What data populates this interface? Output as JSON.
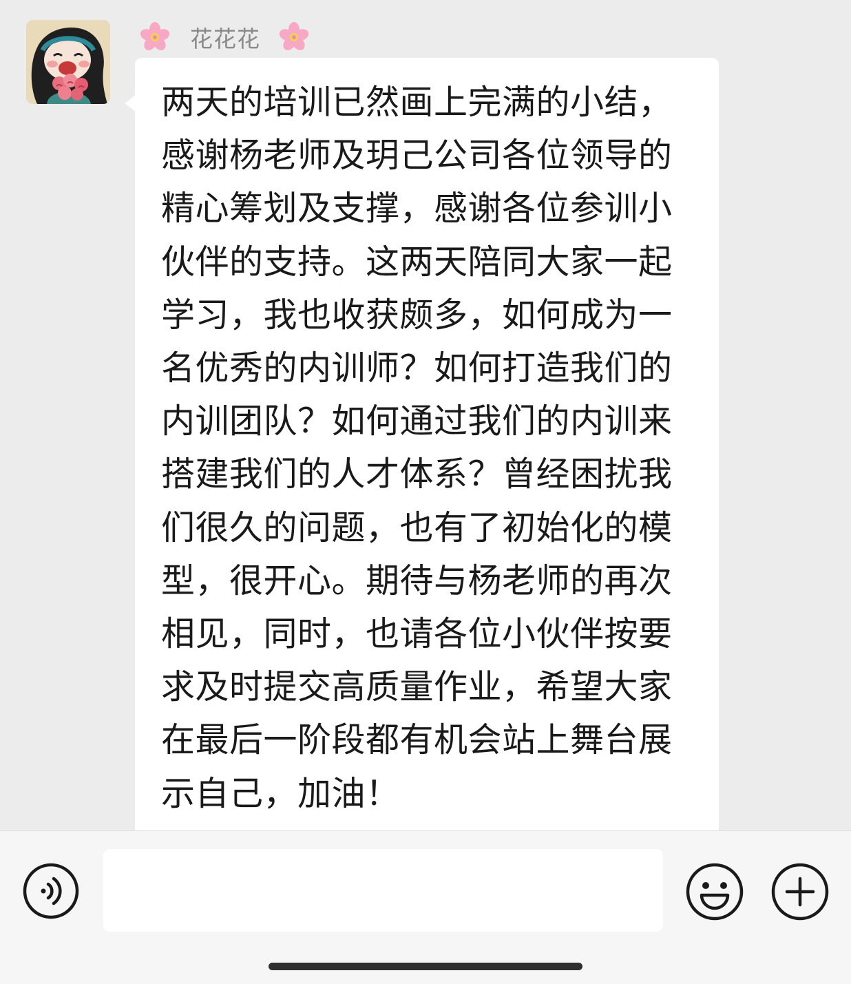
{
  "message": {
    "sender_name": "花花花",
    "text": "两天的培训已然画上完满的小结，感谢杨老师及玥己公司各位领导的精心筹划及支撑，感谢各位参训小伙伴的支持。这两天陪同大家一起学习，我也收获颇多，如何成为一名优秀的内训师？如何打造我们的内训团队？如何通过我们的内训来搭建我们的人才体系？曾经困扰我们很久的问题，也有了初始化的模型，很开心。期待与杨老师的再次相见，同时，也请各位小伙伴按要求及时提交高质量作业，希望大家在最后一阶段都有机会站上舞台展示自己，加油！"
  },
  "icons": {
    "name_left": "cherry-blossom-icon",
    "name_right": "cherry-blossom-icon",
    "voice": "voice-icon",
    "emoji": "smiley-icon",
    "add": "plus-icon"
  },
  "colors": {
    "background": "#ececec",
    "bubble": "#ffffff",
    "sender_name": "#8a8a8a",
    "text": "#1a1a1a"
  },
  "input": {
    "value": "",
    "placeholder": ""
  }
}
